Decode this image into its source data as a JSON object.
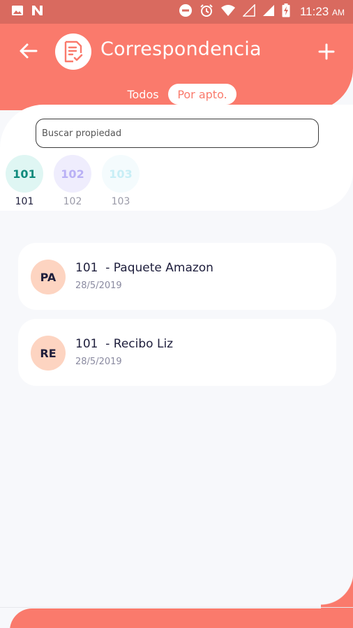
{
  "status_bar": {
    "time": "11:23",
    "ampm": "AM"
  },
  "header": {
    "title": "Correspondencia",
    "back_icon": "arrow-left-icon",
    "add_icon": "plus-icon",
    "logo_icon": "document-check-icon"
  },
  "tabs": {
    "todos": "Todos",
    "por_apto": "Por apto."
  },
  "search": {
    "placeholder": "Buscar propiedad",
    "value": ""
  },
  "apartments": [
    {
      "code": "101",
      "label": "101",
      "bg": "#dff6f3",
      "fg": "#0e8a7c",
      "label_color": "#1e1e3c"
    },
    {
      "code": "102",
      "label": "102",
      "bg": "#efedfd",
      "fg": "#b9b0f5",
      "label_color": "#9a9aa8"
    },
    {
      "code": "103",
      "label": "103",
      "bg": "#f4fbfd",
      "fg": "#c8eef6",
      "label_color": "#9a9aa8"
    }
  ],
  "items": [
    {
      "initials": "PA",
      "title": "101  - Paquete Amazon",
      "date": "28/5/2019"
    },
    {
      "initials": "RE",
      "title": "101  - Recibo Liz",
      "date": "28/5/2019"
    }
  ],
  "colors": {
    "primary": "#fa7a6c",
    "status_bar": "#d96a5f",
    "avatar_bg": "#fdd4c1"
  }
}
